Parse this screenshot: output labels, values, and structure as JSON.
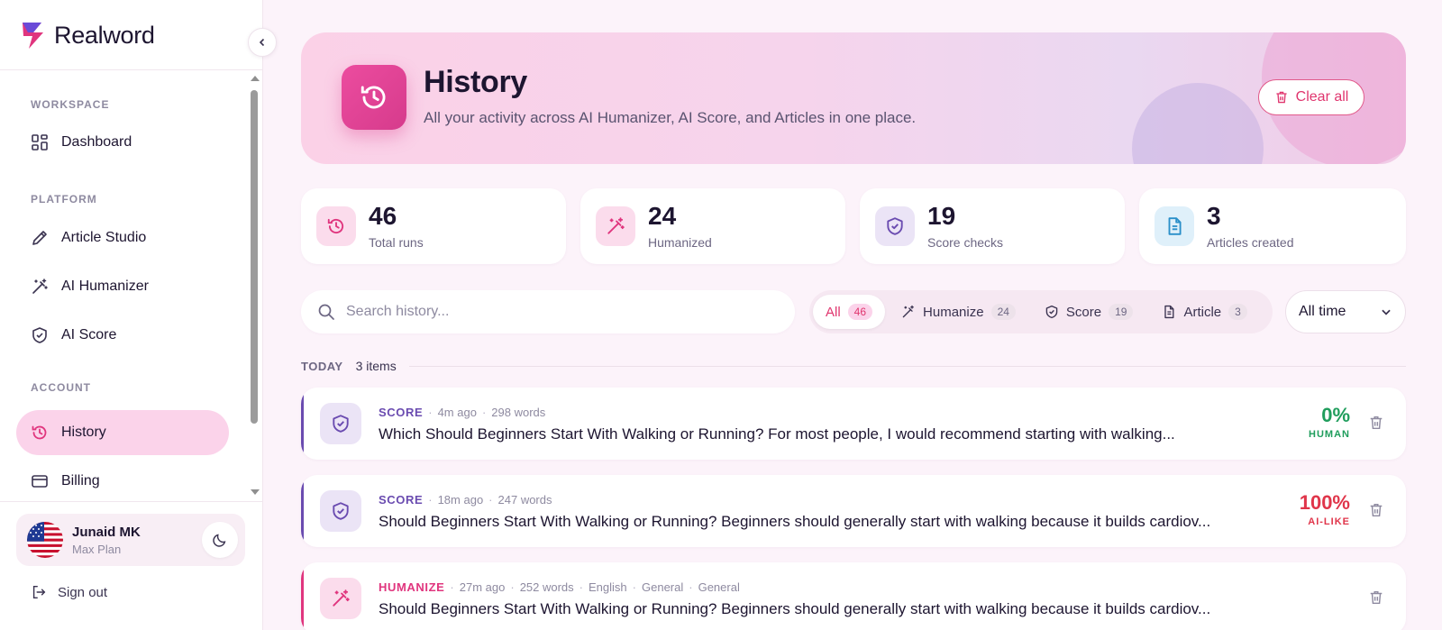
{
  "app": {
    "name": "Realword"
  },
  "sidebar": {
    "sections": [
      {
        "label": "WORKSPACE"
      },
      {
        "label": "PLATFORM"
      },
      {
        "label": "ACCOUNT"
      }
    ],
    "items": [
      {
        "label": "Dashboard",
        "icon": "dashboard-icon"
      },
      {
        "label": "Article Studio",
        "icon": "pen-icon"
      },
      {
        "label": "AI Humanizer",
        "icon": "magic-wand-icon"
      },
      {
        "label": "AI Score",
        "icon": "shield-check-icon"
      },
      {
        "label": "History",
        "icon": "history-icon",
        "active": true
      },
      {
        "label": "Billing",
        "icon": "credit-card-icon"
      }
    ],
    "user": {
      "name": "Junaid MK",
      "plan": "Max Plan"
    },
    "sign_out": "Sign out"
  },
  "hero": {
    "title": "History",
    "subtitle": "All your activity across AI Humanizer, AI Score, and Articles in one place.",
    "clear_label": "Clear all"
  },
  "stats": [
    {
      "value": "46",
      "label": "Total runs",
      "icon": "history-icon"
    },
    {
      "value": "24",
      "label": "Humanized",
      "icon": "magic-wand-icon"
    },
    {
      "value": "19",
      "label": "Score checks",
      "icon": "shield-check-icon"
    },
    {
      "value": "3",
      "label": "Articles created",
      "icon": "document-icon"
    }
  ],
  "search": {
    "placeholder": "Search history...",
    "value": ""
  },
  "filters": [
    {
      "label": "All",
      "count": "46",
      "active": true
    },
    {
      "label": "Humanize",
      "count": "24"
    },
    {
      "label": "Score",
      "count": "19"
    },
    {
      "label": "Article",
      "count": "3"
    }
  ],
  "time_filter": {
    "selected": "All time"
  },
  "group": {
    "label": "TODAY",
    "count": "3 items"
  },
  "items": [
    {
      "type": "SCORE",
      "meta": [
        "4m ago",
        "298 words"
      ],
      "title": "Which Should Beginners Start With Walking or Running? For most people, I would recommend starting with walking...",
      "score": "0%",
      "score_label": "HUMAN"
    },
    {
      "type": "SCORE",
      "meta": [
        "18m ago",
        "247 words"
      ],
      "title": "Should Beginners Start With Walking or Running? Beginners should generally start with walking because it builds cardiov...",
      "score": "100%",
      "score_label": "AI-LIKE"
    },
    {
      "type": "HUMANIZE",
      "meta": [
        "27m ago",
        "252 words",
        "English",
        "General",
        "General"
      ],
      "title": "Should Beginners Start With Walking or Running? Beginners should generally start with walking because it builds cardiov..."
    }
  ],
  "colors": {
    "accent": "#e0356e",
    "score_accent": "#6a4bb0",
    "humanize_accent": "#e0357e",
    "human_green": "#1f9d5c",
    "ai_red": "#e0354a"
  }
}
